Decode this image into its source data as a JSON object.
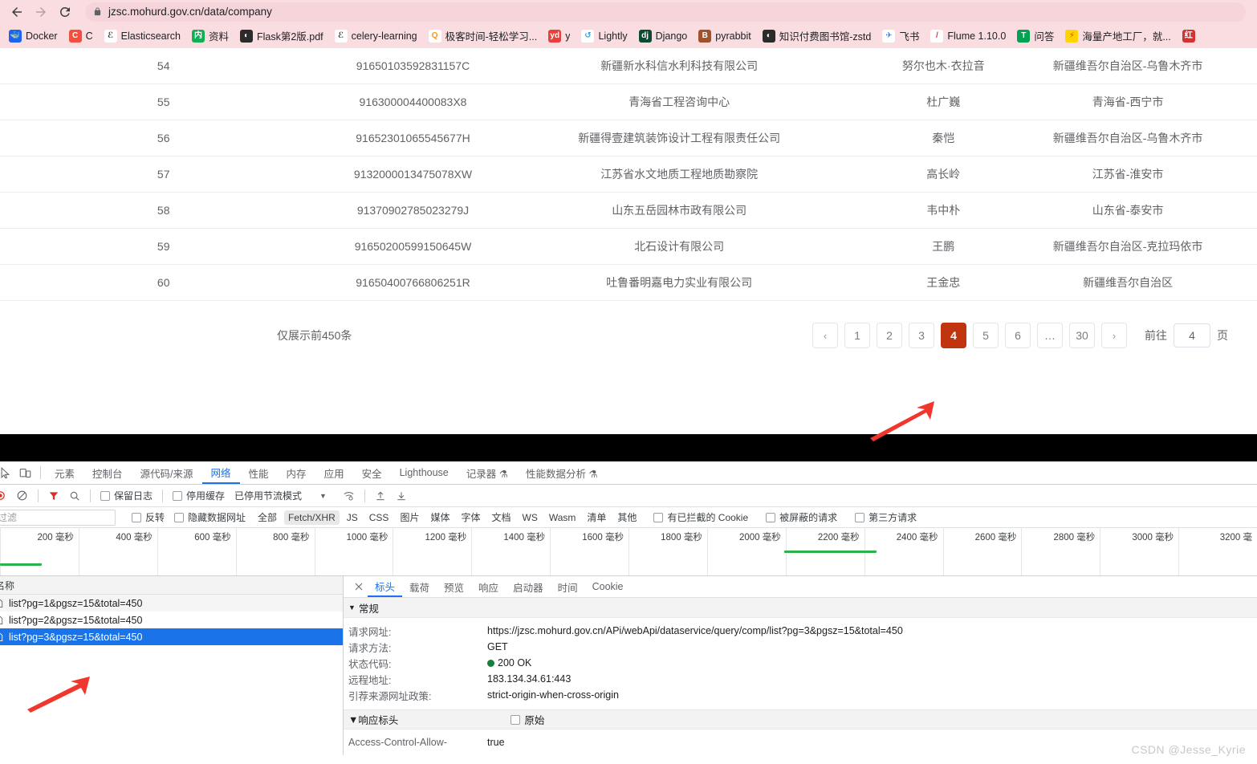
{
  "browser": {
    "back_icon": "back-arrow-icon",
    "forward_icon": "forward-arrow-icon",
    "reload_icon": "reload-icon",
    "url": "jzsc.mohurd.gov.cn/data/company",
    "bookmarks": [
      {
        "label": "Docker",
        "glyph": "🐳",
        "bg": "#1d63ed",
        "fg": "#ffffff"
      },
      {
        "label": "C",
        "glyph": "C",
        "bg": "#f2503f",
        "fg": "#ffffff"
      },
      {
        "label": "Elasticsearch",
        "glyph": "ℰ",
        "bg": "#ffffff",
        "fg": "#343741"
      },
      {
        "label": "资料",
        "glyph": "内",
        "bg": "#12b055",
        "fg": "#ffffff"
      },
      {
        "label": "Flask第2版.pdf",
        "glyph": "◐",
        "bg": "#2b2b2b",
        "fg": "#ffffff"
      },
      {
        "label": "celery-learning",
        "glyph": "ℰ",
        "bg": "#ffffff",
        "fg": "#343741"
      },
      {
        "label": "极客时间-轻松学习...",
        "glyph": "Q",
        "bg": "#ffffff",
        "fg": "#f7931e"
      },
      {
        "label": "y",
        "glyph": "yd",
        "bg": "#e8413c",
        "fg": "#ffffff"
      },
      {
        "label": "Lightly",
        "glyph": "↺",
        "bg": "#ffffff",
        "fg": "#3b9fe0"
      },
      {
        "label": "Django",
        "glyph": "dj",
        "bg": "#0c4b33",
        "fg": "#ffffff"
      },
      {
        "label": "pyrabbit",
        "glyph": "B",
        "bg": "#a0522d",
        "fg": "#ffffff"
      },
      {
        "label": "知识付费图书馆-zstd",
        "glyph": "◐",
        "bg": "#2b2b2b",
        "fg": "#ffffff"
      },
      {
        "label": "飞书",
        "glyph": "✈",
        "bg": "#ffffff",
        "fg": "#2f7ef5"
      },
      {
        "label": "Flume 1.10.0",
        "glyph": "/",
        "bg": "#ffffff",
        "fg": "#e0366a"
      },
      {
        "label": "问答",
        "glyph": "T",
        "bg": "#00a352",
        "fg": "#ffffff"
      },
      {
        "label": "海量产地工厂，就...",
        "glyph": "⚡",
        "bg": "#ffd400",
        "fg": "#e23b1f"
      },
      {
        "label": "",
        "glyph": "红",
        "bg": "#d1342f",
        "fg": "#ffffff"
      }
    ]
  },
  "table": {
    "rows": [
      {
        "index": "54",
        "code": "91650103592831157C",
        "name": "新疆新水科信水利科技有限公司",
        "person": "努尔也木·衣拉音",
        "region": "新疆维吾尔自治区-乌鲁木齐市"
      },
      {
        "index": "55",
        "code": "916300004400083X8",
        "name": "青海省工程咨询中心",
        "person": "杜广巍",
        "region": "青海省-西宁市"
      },
      {
        "index": "56",
        "code": "91652301065545677H",
        "name": "新疆得壹建筑装饰设计工程有限责任公司",
        "person": "秦恺",
        "region": "新疆维吾尔自治区-乌鲁木齐市"
      },
      {
        "index": "57",
        "code": "9132000013475078XW",
        "name": "江苏省水文地质工程地质勘察院",
        "person": "高长岭",
        "region": "江苏省-淮安市"
      },
      {
        "index": "58",
        "code": "91370902785023279J",
        "name": "山东五岳园林市政有限公司",
        "person": "韦中朴",
        "region": "山东省-泰安市"
      },
      {
        "index": "59",
        "code": "91650200599150645W",
        "name": "北石设计有限公司",
        "person": "王鹏",
        "region": "新疆维吾尔自治区-克拉玛依市"
      },
      {
        "index": "60",
        "code": "91650400766806251R",
        "name": "吐鲁番明嘉电力实业有限公司",
        "person": "王金忠",
        "region": "新疆维吾尔自治区"
      }
    ],
    "footer_note": "仅展示前450条",
    "pager": {
      "prev": "‹",
      "pages": [
        "1",
        "2",
        "3",
        "4",
        "5",
        "6",
        "…",
        "30"
      ],
      "active": "4",
      "next": "›",
      "goto_label": "前往",
      "goto_value": "4",
      "goto_unit": "页",
      "active_color": "#c0350f"
    }
  },
  "devtools": {
    "panel_tabs": [
      {
        "label": "元素",
        "active": false
      },
      {
        "label": "控制台",
        "active": false
      },
      {
        "label": "源代码/来源",
        "active": false
      },
      {
        "label": "网络",
        "active": true
      },
      {
        "label": "性能",
        "active": false
      },
      {
        "label": "内存",
        "active": false
      },
      {
        "label": "应用",
        "active": false
      },
      {
        "label": "安全",
        "active": false
      },
      {
        "label": "Lighthouse",
        "active": false
      },
      {
        "label": "记录器 ⚗",
        "active": false
      },
      {
        "label": "性能数据分析 ⚗",
        "active": false
      }
    ],
    "toolbar": {
      "record_icon": "record-icon",
      "clear_icon": "clear-icon",
      "filter_icon": "filter-icon",
      "search_icon": "search-icon",
      "preserve_log": "保留日志",
      "disable_cache": "停用缓存",
      "throttling": "已停用节流模式",
      "wifi_icon": "network-conditions-icon",
      "import_icon": "import-har-icon",
      "export_icon": "export-har-icon"
    },
    "filterbar": {
      "filter_placeholder": "过滤",
      "invert": "反转",
      "hide_data_urls": "隐藏数据网址",
      "types": [
        "全部",
        "Fetch/XHR",
        "JS",
        "CSS",
        "图片",
        "媒体",
        "字体",
        "文档",
        "WS",
        "Wasm",
        "清单",
        "其他"
      ],
      "selected_type": "Fetch/XHR",
      "blocked_cookies": "有已拦截的 Cookie",
      "blocked_requests": "被屏蔽的请求",
      "third_party": "第三方请求"
    },
    "timeline": {
      "ticks": [
        "200 毫秒",
        "400 毫秒",
        "600 毫秒",
        "800 毫秒",
        "1000 毫秒",
        "1200 毫秒",
        "1400 毫秒",
        "1600 毫秒",
        "1800 毫秒",
        "2000 毫秒",
        "2200 毫秒",
        "2400 毫秒",
        "2600 毫秒",
        "2800 毫秒",
        "3000 毫秒",
        "3200 毫"
      ],
      "bar_color": "#2bb44a"
    },
    "requests": {
      "header": "名称",
      "items": [
        {
          "name": "list?pg=1&pgsz=15&total=450",
          "selected": false
        },
        {
          "name": "list?pg=2&pgsz=15&total=450",
          "selected": false
        },
        {
          "name": "list?pg=3&pgsz=15&total=450",
          "selected": true
        }
      ]
    },
    "detail": {
      "close_icon": "close-icon",
      "tabs": [
        {
          "label": "标头",
          "active": true
        },
        {
          "label": "载荷",
          "active": false
        },
        {
          "label": "预览",
          "active": false
        },
        {
          "label": "响应",
          "active": false
        },
        {
          "label": "启动器",
          "active": false
        },
        {
          "label": "时间",
          "active": false
        },
        {
          "label": "Cookie",
          "active": false
        }
      ],
      "general_section": "常规",
      "general_rows": [
        {
          "key": "请求网址:",
          "value": "https://jzsc.mohurd.gov.cn/APi/webApi/dataservice/query/comp/list?pg=3&pgsz=15&total=450",
          "status": false
        },
        {
          "key": "请求方法:",
          "value": "GET",
          "status": false
        },
        {
          "key": "状态代码:",
          "value": "200 OK",
          "status": true
        },
        {
          "key": "远程地址:",
          "value": "183.134.34.61:443",
          "status": false
        },
        {
          "key": "引荐来源网址政策:",
          "value": "strict-origin-when-cross-origin",
          "status": false
        }
      ],
      "response_section": "响应标头",
      "raw_label": "原始",
      "response_rows": [
        {
          "key": "Access-Control-Allow-",
          "value": "true"
        }
      ]
    }
  },
  "watermark": "CSDN @Jesse_Kyrie"
}
